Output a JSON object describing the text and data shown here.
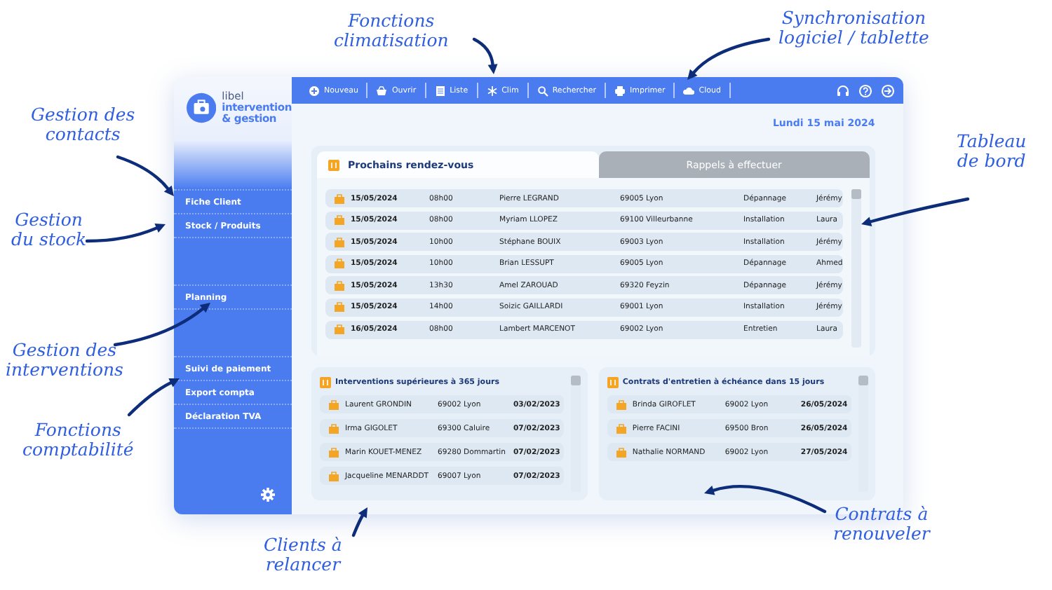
{
  "app": {
    "logo": {
      "lines": [
        "libel",
        "intervention",
        "& gestion"
      ]
    },
    "toolbar": {
      "buttons": [
        {
          "label": "Nouveau"
        },
        {
          "label": "Ouvrir"
        },
        {
          "label": "Liste"
        },
        {
          "label": "Clim"
        },
        {
          "label": "Rechercher"
        },
        {
          "label": "Imprimer"
        },
        {
          "label": "Cloud"
        }
      ]
    },
    "sidebar": {
      "groups": [
        [
          {
            "label": "Fiche Client"
          },
          {
            "label": "Stock / Produits"
          }
        ],
        [
          {
            "label": "Planning"
          }
        ],
        [
          {
            "label": "Suivi de paiement"
          },
          {
            "label": "Export compta"
          },
          {
            "label": "Déclaration TVA"
          }
        ]
      ]
    },
    "date": "Lundi 15 mai 2024",
    "tabs": [
      {
        "label": "Prochains rendez-vous",
        "selected": true
      },
      {
        "label": "Rappels à effectuer",
        "selected": false
      }
    ],
    "appointments": [
      {
        "date": "15/05/2024",
        "time": "08h00",
        "name": "Pierre LEGRAND",
        "city": "69005 Lyon",
        "type": "Dépannage",
        "technician": "Jérémy"
      },
      {
        "date": "15/05/2024",
        "time": "08h00",
        "name": "Myriam LLOPEZ",
        "city": "69100 Villeurbanne",
        "type": "Installation",
        "technician": "Laura"
      },
      {
        "date": "15/05/2024",
        "time": "10h00",
        "name": "Stéphane BOUIX",
        "city": "69003 Lyon",
        "type": "Installation",
        "technician": "Jérémy"
      },
      {
        "date": "15/05/2024",
        "time": "10h00",
        "name": "Brian LESSUPT",
        "city": "69005 Lyon",
        "type": "Dépannage",
        "technician": "Ahmed"
      },
      {
        "date": "15/05/2024",
        "time": "13h30",
        "name": "Amel ZAROUAD",
        "city": "69320 Feyzin",
        "type": "Dépannage",
        "technician": "Jérémy"
      },
      {
        "date": "15/05/2024",
        "time": "14h00",
        "name": "Soizic GAILLARDI",
        "city": "69001 Lyon",
        "type": "Installation",
        "technician": "Jérémy"
      },
      {
        "date": "16/05/2024",
        "time": "08h00",
        "name": "Lambert MARCENOT",
        "city": "69002 Lyon",
        "type": "Entretien",
        "technician": "Laura"
      }
    ],
    "panels": [
      {
        "title": "Interventions supérieures à 365 jours",
        "rows": [
          {
            "name": "Laurent GRONDIN",
            "city": "69002 Lyon",
            "date": "03/02/2023"
          },
          {
            "name": "Irma GIGOLET",
            "city": "69300 Caluire",
            "date": "07/02/2023"
          },
          {
            "name": "Marin KOUET-MENEZ",
            "city": "69280 Dommartin",
            "date": "07/02/2023"
          },
          {
            "name": "Jacqueline MENARDDT",
            "city": "69007 Lyon",
            "date": "07/02/2023"
          }
        ]
      },
      {
        "title": "Contrats d'entretien à échéance dans 15 jours",
        "rows": [
          {
            "name": "Brinda GIROFLET",
            "city": "69002 Lyon",
            "date": "26/05/2024"
          },
          {
            "name": "Pierre FACINI",
            "city": "69500 Bron",
            "date": "26/05/2024"
          },
          {
            "name": "Nathalie NORMAND",
            "city": "69002 Lyon",
            "date": "27/05/2024"
          }
        ]
      }
    ]
  },
  "annotations": [
    {
      "lines": [
        "Fonctions",
        "climatisation"
      ]
    },
    {
      "lines": [
        "Synchronisation",
        "logiciel / tablette"
      ]
    },
    {
      "lines": [
        "Gestion des",
        "contacts"
      ]
    },
    {
      "lines": [
        "Tableau",
        "de bord"
      ]
    },
    {
      "lines": [
        "Gestion",
        "du stock"
      ]
    },
    {
      "lines": [
        "Gestion des",
        "interventions"
      ]
    },
    {
      "lines": [
        "Fonctions",
        "comptabilité"
      ]
    },
    {
      "lines": [
        "Clients à",
        "relancer"
      ]
    },
    {
      "lines": [
        "Contrats à",
        "renouveler"
      ]
    }
  ]
}
